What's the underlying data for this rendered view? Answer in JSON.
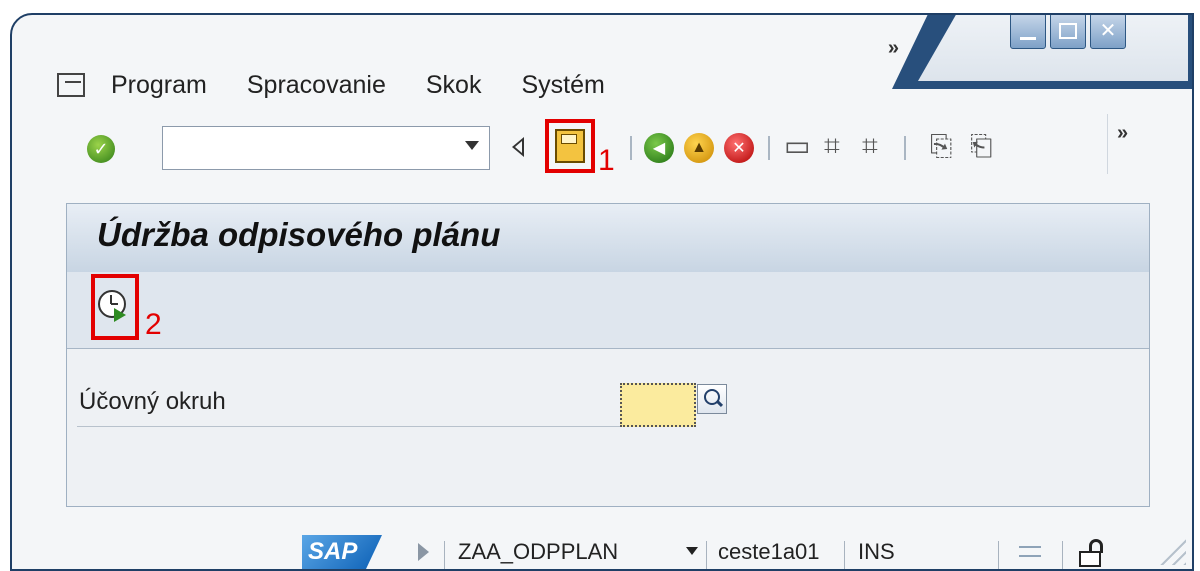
{
  "window": {
    "more_symbol": "»"
  },
  "menu": {
    "items": [
      "Program",
      "Spracovanie",
      "Skok",
      "Systém"
    ]
  },
  "toolbar": {
    "more_symbol": "»",
    "annotation_save": "1"
  },
  "screen": {
    "title": "Údržba odpisového plánu",
    "annotation_execute": "2"
  },
  "form": {
    "field_label": "Účovný okruh",
    "field_value": ""
  },
  "status": {
    "logo_text": "SAP",
    "transaction": "ZAA_ODPPLAN",
    "server": "ceste1a01",
    "mode": "INS"
  },
  "colors": {
    "highlight": "#e30000",
    "required_field": "#fbeb9e",
    "frame": "#1f3f66"
  }
}
